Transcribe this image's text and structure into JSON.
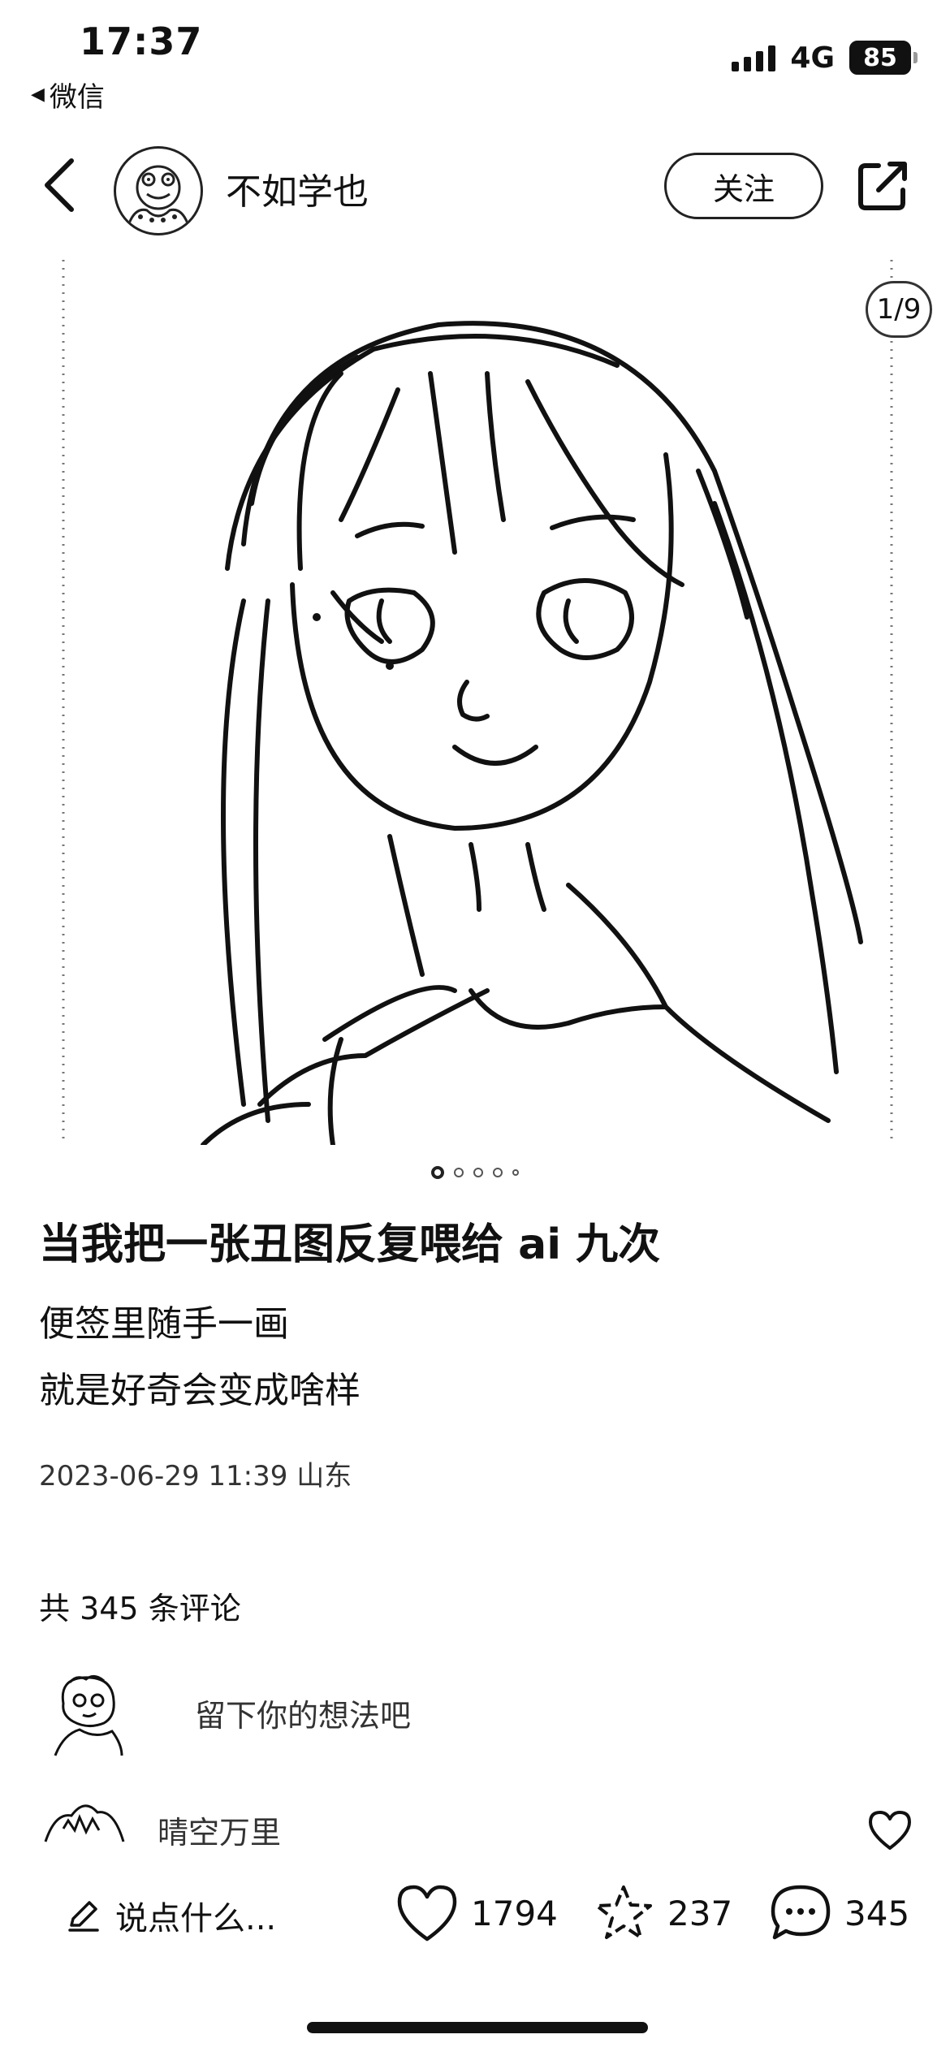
{
  "status_bar": {
    "time": "17:37",
    "back_app": "微信",
    "network": "4G",
    "battery": "85"
  },
  "header": {
    "author_name": "不如学也",
    "follow_label": "关注"
  },
  "image": {
    "counter": "1/9",
    "dots_total": 5,
    "dot_active": 1
  },
  "post": {
    "title": "当我把一张丑图反复喂给 ai 九次",
    "body_lines": [
      "便签里随手一画",
      "就是好奇会变成啥样"
    ],
    "date_location": "2023-06-29 11:39 山东"
  },
  "comments": {
    "count_label": "共 345 条评论",
    "input_placeholder": "留下你的想法吧",
    "first_user": "晴空万里"
  },
  "bottom_bar": {
    "say_label": "说点什么...",
    "likes": "1794",
    "collects": "237",
    "comments": "345"
  }
}
